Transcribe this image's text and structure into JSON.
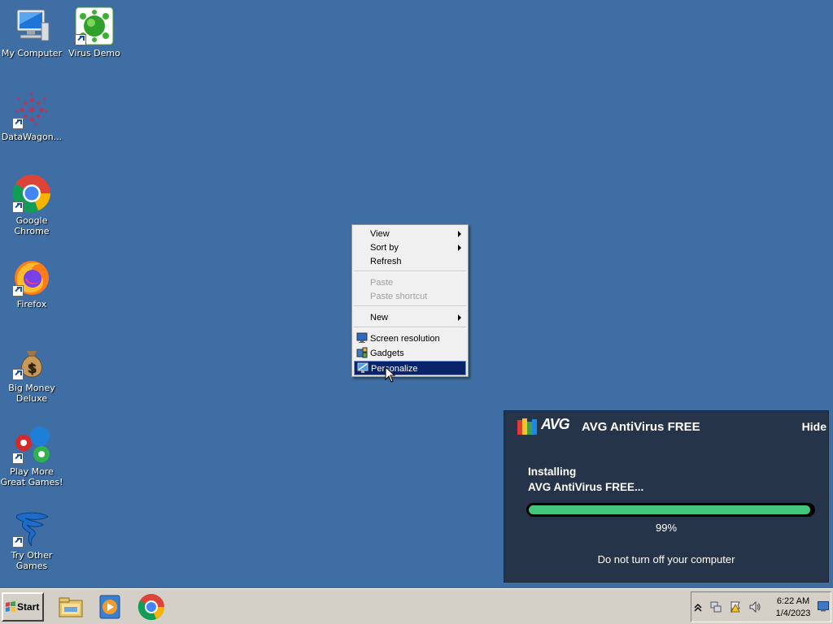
{
  "desktop": {
    "icons": [
      {
        "label": "My Computer",
        "icon": "computer-icon"
      },
      {
        "label": "Virus Demo",
        "icon": "virus-icon"
      },
      {
        "label": "DataWagon...",
        "icon": "datawagon-icon"
      },
      {
        "label": "Google Chrome",
        "icon": "chrome-icon"
      },
      {
        "label": "Firefox",
        "icon": "firefox-icon"
      },
      {
        "label": "Big Money Deluxe",
        "icon": "money-bag-icon"
      },
      {
        "label": "Play More Great Games!",
        "icon": "games-icon"
      },
      {
        "label": "Try Other Games",
        "icon": "tornado-icon"
      }
    ]
  },
  "context_menu": {
    "items": [
      {
        "label": "View",
        "submenu": true
      },
      {
        "label": "Sort by",
        "submenu": true
      },
      {
        "label": "Refresh"
      },
      {
        "label": "Paste",
        "disabled": true
      },
      {
        "label": "Paste shortcut",
        "disabled": true
      },
      {
        "label": "New",
        "submenu": true
      },
      {
        "label": "Screen resolution",
        "icon": "monitor-icon"
      },
      {
        "label": "Gadgets",
        "icon": "gadgets-icon"
      },
      {
        "label": "Personalize",
        "icon": "personalize-icon",
        "selected": true
      }
    ]
  },
  "avg_popup": {
    "logo_text": "AVG",
    "title": "AVG AntiVirus FREE",
    "hide_label": "Hide",
    "status_line1": "Installing",
    "status_line2": "AVG AntiVirus FREE...",
    "progress": 0.99,
    "progress_label": "99%",
    "note": "Do not turn off your computer",
    "accent_color": "#42c77d"
  },
  "taskbar": {
    "start_label": "Start",
    "pinned": [
      "file-explorer-icon",
      "media-player-icon",
      "chrome-icon"
    ],
    "tray_icons": [
      "show-hidden-icons-arrow",
      "network-icon",
      "action-center-flag-icon",
      "volume-icon"
    ],
    "clock_time": "6:22 AM",
    "clock_date": "1/4/2023"
  }
}
